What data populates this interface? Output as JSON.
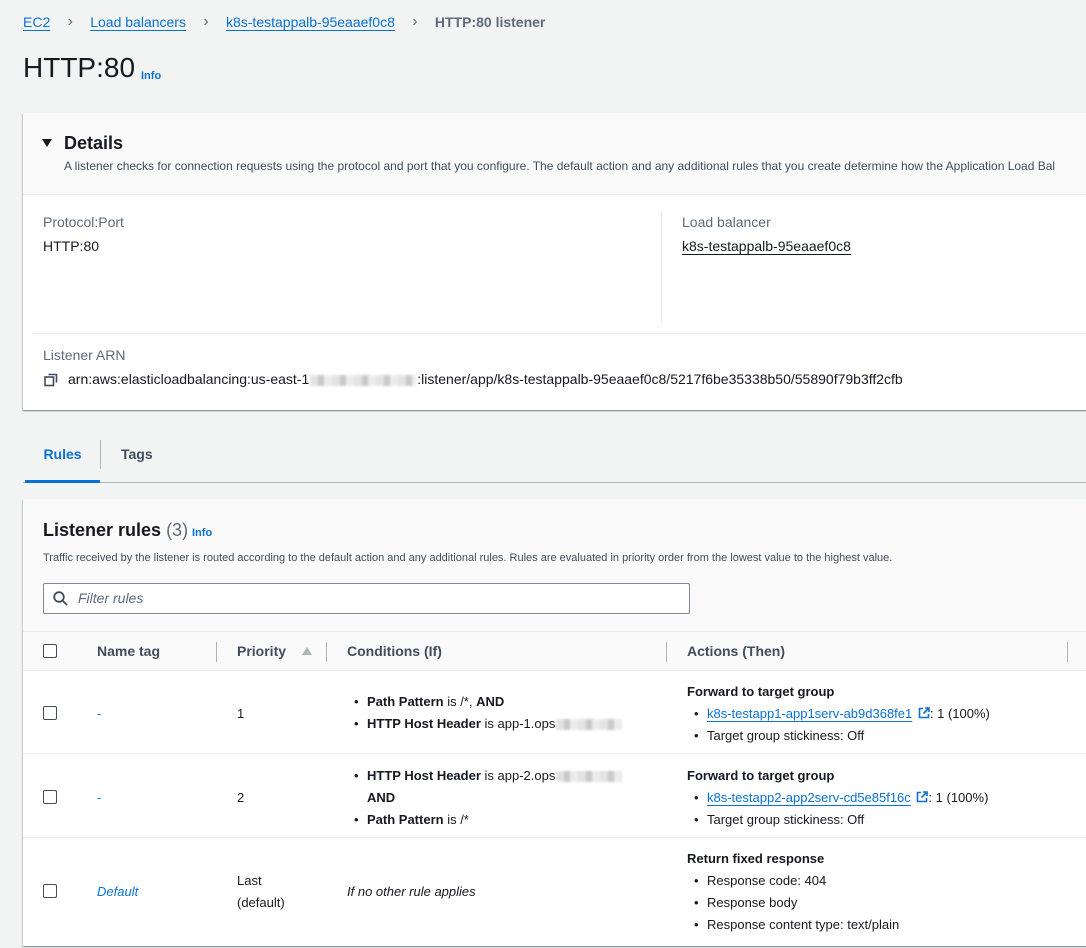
{
  "breadcrumb": {
    "items": [
      "EC2",
      "Load balancers",
      "k8s-testappalb-95eaaef0c8"
    ],
    "current": "HTTP:80 listener"
  },
  "page": {
    "title": "HTTP:80",
    "info": "Info"
  },
  "details": {
    "title": "Details",
    "description": "A listener checks for connection requests using the protocol and port that you configure. The default action and any additional rules that you create determine how the Application Load Bal",
    "protocol_port_label": "Protocol:Port",
    "protocol_port_value": "HTTP:80",
    "load_balancer_label": "Load balancer",
    "load_balancer_value": "k8s-testappalb-95eaaef0c8",
    "arn_label": "Listener ARN",
    "arn_prefix": "arn:aws:elasticloadbalancing:us-east-1",
    "arn_suffix": ":listener/app/k8s-testappalb-95eaaef0c8/5217f6be35338b50/55890f79b3ff2cfb"
  },
  "tabs": [
    "Rules",
    "Tags"
  ],
  "rules": {
    "title": "Listener rules",
    "count": "(3)",
    "info": "Info",
    "description": "Traffic received by the listener is routed according to the default action and any additional rules. Rules are evaluated in priority order from the lowest value to the highest value.",
    "filter_placeholder": "Filter rules",
    "columns": [
      "Name tag",
      "Priority",
      "Conditions (If)",
      "Actions (Then)"
    ],
    "rows": [
      {
        "name": "-",
        "priority": "1",
        "cond1_key": "Path Pattern",
        "cond1_rest": " is /*, ",
        "cond1_and": "AND",
        "cond2_key": "HTTP Host Header",
        "cond2_rest": " is app-1.ops",
        "action_title": "Forward to target group",
        "target": "k8s-testapp1-app1serv-ab9d368fe1",
        "weight": ": 1 (100%)",
        "stickiness": "Target group stickiness: Off"
      },
      {
        "name": "-",
        "priority": "2",
        "cond1_key": "HTTP Host Header",
        "cond1_rest": " is app-2.ops",
        "cond1_and": "AND",
        "cond2_key": "Path Pattern",
        "cond2_rest": " is /*",
        "action_title": "Forward to target group",
        "target": "k8s-testapp2-app2serv-cd5e85f16c",
        "weight": ": 1 (100%)",
        "stickiness": "Target group stickiness: Off"
      },
      {
        "name": "Default",
        "priority_line1": "Last",
        "priority_line2": "(default)",
        "condition": "If no other rule applies",
        "action_title": "Return fixed response",
        "items": [
          "Response code: 404",
          "Response body",
          "Response content type: text/plain"
        ]
      }
    ]
  }
}
